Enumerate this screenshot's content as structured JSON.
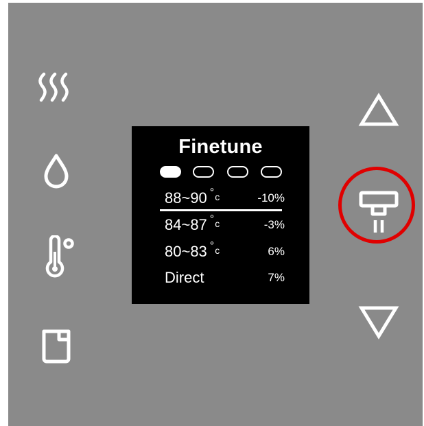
{
  "screen": {
    "title": "Finetune",
    "indicators": [
      {
        "active": true
      },
      {
        "active": false
      },
      {
        "active": false
      },
      {
        "active": false
      }
    ],
    "rows": [
      {
        "range": "88~90",
        "unit": "c",
        "degree": "°",
        "adjust": "-10%"
      },
      {
        "range": "84~87",
        "unit": "c",
        "degree": "°",
        "adjust": "-3%"
      },
      {
        "range": "80~83",
        "unit": "c",
        "degree": "°",
        "adjust": "6%"
      },
      {
        "range": "Direct",
        "unit": "",
        "degree": "",
        "adjust": "7%"
      }
    ]
  },
  "left_buttons": [
    {
      "icon": "steam-icon"
    },
    {
      "icon": "water-drop-icon"
    },
    {
      "icon": "thermometer-icon"
    },
    {
      "icon": "cup-icon"
    }
  ],
  "right_buttons": [
    {
      "icon": "arrow-up-icon"
    },
    {
      "icon": "dispense-icon",
      "highlighted": true
    },
    {
      "icon": "arrow-down-icon"
    }
  ],
  "colors": {
    "panel": "#8a8a8a",
    "screen": "#000000",
    "foreground": "#ffffff",
    "highlight": "#e00000"
  }
}
